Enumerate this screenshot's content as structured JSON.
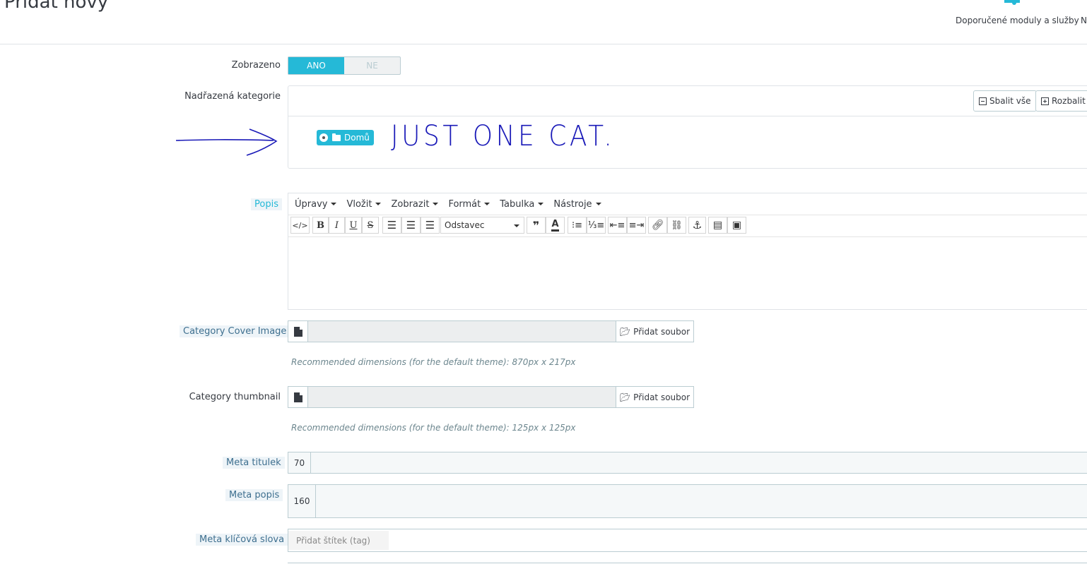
{
  "header": {
    "title": "Přidat nový",
    "modules_link": "Doporučené moduly a služby",
    "next_link": "N"
  },
  "form": {
    "displayed": {
      "label": "Zobrazeno",
      "on": "ANO",
      "off": "NE",
      "value": "ANO"
    },
    "parent_category": {
      "label": "Nadřazená kategorie",
      "collapse_all": "Sbalit vše",
      "expand_all": "Rozbalit v",
      "tree_item": "Domů",
      "annotation": "JUST ONE CAT."
    },
    "description": {
      "label": "Popis",
      "menus": [
        "Úpravy",
        "Vložit",
        "Zobrazit",
        "Formát",
        "Tabulka",
        "Nástroje"
      ],
      "format_select": "Odstavec"
    },
    "cover_image": {
      "label": "Category Cover Image",
      "button": "Přidat soubor",
      "hint": "Recommended dimensions (for the default theme): 870px x 217px"
    },
    "thumbnail": {
      "label": "Category thumbnail",
      "button": "Přidat soubor",
      "hint": "Recommended dimensions (for the default theme): 125px x 125px"
    },
    "meta_title": {
      "label": "Meta titulek",
      "counter": "70"
    },
    "meta_description": {
      "label": "Meta popis",
      "counter": "160"
    },
    "meta_keywords": {
      "label": "Meta klíčová slova",
      "placeholder": "Přidat štítek (tag)"
    }
  },
  "colors": {
    "accent": "#25b9d7",
    "annotation_ink": "#1a1ab8"
  }
}
